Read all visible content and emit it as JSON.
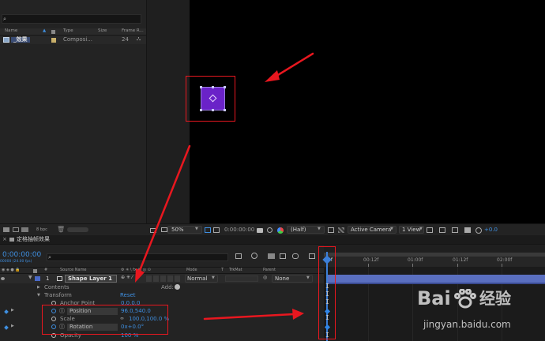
{
  "project": {
    "columns": {
      "name": "Name",
      "type": "Type",
      "size": "Size",
      "frame_rate": "Frame R..."
    },
    "item": {
      "name": "_效果",
      "type": "Composi...",
      "frame_rate": "24"
    },
    "bpc": "8 bpc"
  },
  "viewer_toolbar": {
    "zoom": "50%",
    "timecode": "0:00:00:00",
    "resolution": "(Half)",
    "camera": "Active Camera",
    "views": "1 View",
    "exposure": "+0.0"
  },
  "timeline": {
    "tab_title": "定格抽帧效果",
    "current_time": "0:00:00:00",
    "frames_fps": "00000 (24.00 fps)",
    "columns": {
      "num": "#",
      "source_name": "Source Name",
      "mode": "Mode",
      "t": "T",
      "trkmat": "TrkMat",
      "parent": "Parent"
    },
    "ruler": [
      "0f",
      "00:12f",
      "01:00f",
      "01:12f",
      "02:00f"
    ],
    "layer": {
      "index": "1",
      "name": "Shape Layer 1",
      "mode": "Normal",
      "parent": "None"
    },
    "contents": {
      "label": "Contents",
      "add_label": "Add:"
    },
    "transform": {
      "label": "Transform",
      "reset_label": "Reset"
    },
    "properties": [
      {
        "name": "Anchor Point",
        "value": "0.0,0.0"
      },
      {
        "name": "Position",
        "value": "96.0,540.0"
      },
      {
        "name": "Scale",
        "value": "100.0,100.0 %"
      },
      {
        "name": "Rotation",
        "value": "0x+0.0°"
      },
      {
        "name": "Opacity",
        "value": "100 %"
      }
    ]
  },
  "watermark": {
    "brand_a": "Bai",
    "brand_b": "经验",
    "url": "jingyan.baidu.com"
  },
  "colors": {
    "accent": "#3f8fe0",
    "shape": "#6a22c8",
    "annotation": "#e8171f"
  }
}
